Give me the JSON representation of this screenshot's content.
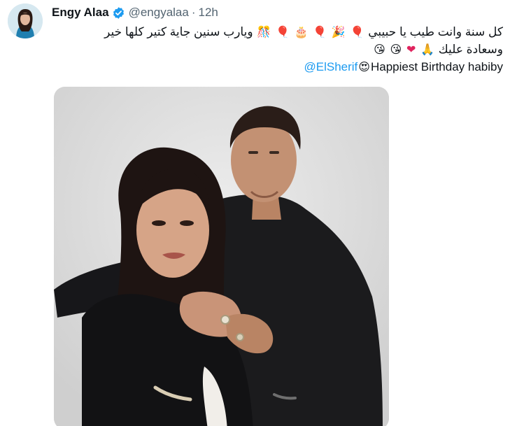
{
  "author": {
    "display_name": "Engy Alaa",
    "handle": "@engyalaa",
    "separator": "·",
    "time_ago": "12h",
    "avatar_icon": "profile-photo",
    "verified_icon": "verified-badge-icon",
    "verified_color": "#1d9bf0"
  },
  "tweet": {
    "line1_text": "كل سنة وانت طيب يا حبيبي",
    "line1_text2": "ويارب سنين جاية كتير كلها خير",
    "line1_emojis": [
      "🎈",
      "🎉",
      "🎈",
      "🎂",
      "🎈",
      "🎊"
    ],
    "line2_text": "وسعادة عليك",
    "line2_emojis": [
      "🙏",
      "❤",
      "😘",
      "😘"
    ],
    "line3_text": "Happiest Birthday habiby",
    "line3_emoji": "😍",
    "mention": "@ElSherif",
    "mention_color": "#1d9bf0"
  },
  "media": {
    "type": "photo",
    "background_color": "#dcdcdc"
  }
}
